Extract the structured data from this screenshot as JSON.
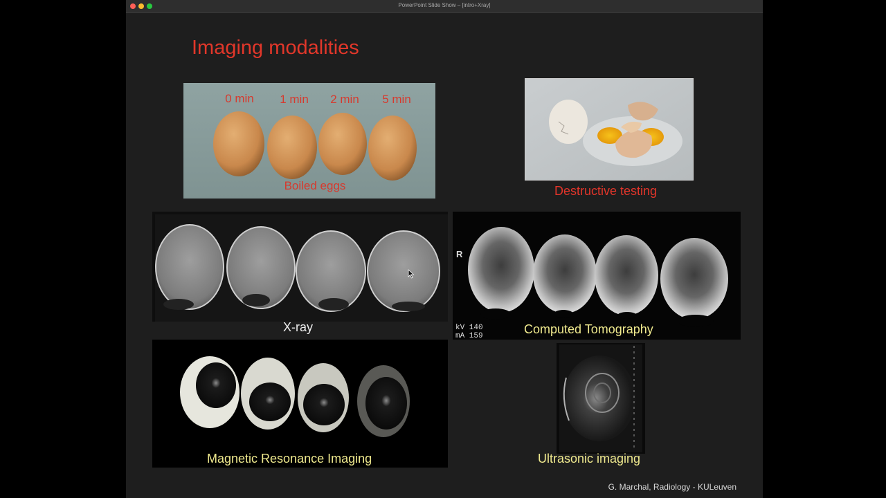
{
  "window": {
    "title": "PowerPoint Slide Show – [intro+Xray]"
  },
  "slide": {
    "title": "Imaging modalities",
    "boiled": {
      "times": [
        "0 min",
        "1 min",
        "2 min",
        "5 min"
      ],
      "caption": "Boiled eggs"
    },
    "destructive_caption": "Destructive testing",
    "xray_caption": "X-ray",
    "ct": {
      "caption": "Computed Tomography",
      "marker": "R",
      "params": [
        "kV 140",
        "mA 159"
      ]
    },
    "mri_caption": "Magnetic Resonance Imaging",
    "us_caption": "Ultrasonic imaging",
    "footer": "G. Marchal, Radiology - KULeuven"
  },
  "colors": {
    "title_red": "#e2372a",
    "caption_yellow": "#efe98e",
    "background": "#1e1e1e"
  }
}
